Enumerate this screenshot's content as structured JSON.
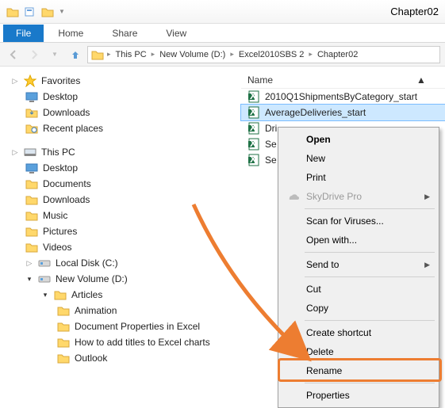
{
  "window": {
    "title": "Chapter02"
  },
  "tabs": {
    "file": "File",
    "home": "Home",
    "share": "Share",
    "view": "View"
  },
  "breadcrumbs": [
    "This PC",
    "New Volume (D:)",
    "Excel2010SBS 2",
    "Chapter02"
  ],
  "favorites": {
    "label": "Favorites",
    "items": [
      "Desktop",
      "Downloads",
      "Recent places"
    ]
  },
  "thispc": {
    "label": "This PC",
    "items": [
      "Desktop",
      "Documents",
      "Downloads",
      "Music",
      "Pictures",
      "Videos",
      "Local Disk (C:)"
    ],
    "newvol": {
      "label": "New Volume (D:)",
      "articles": {
        "label": "Articles",
        "items": [
          "Animation",
          "Document Properties in Excel",
          "How to add titles to Excel charts",
          "Outlook"
        ]
      }
    }
  },
  "column": {
    "name": "Name"
  },
  "files": [
    "2010Q1ShipmentsByCategory_start",
    "AverageDeliveries_start",
    "Dri",
    "Se",
    "Se"
  ],
  "selected_index": 1,
  "context_menu": {
    "open": "Open",
    "new": "New",
    "print": "Print",
    "skydrive": "SkyDrive Pro",
    "scan": "Scan for Viruses...",
    "openwith": "Open with...",
    "sendto": "Send to",
    "cut": "Cut",
    "copy": "Copy",
    "shortcut": "Create shortcut",
    "delete": "Delete",
    "rename": "Rename",
    "properties": "Properties"
  },
  "colors": {
    "accent": "#ed7d31"
  }
}
